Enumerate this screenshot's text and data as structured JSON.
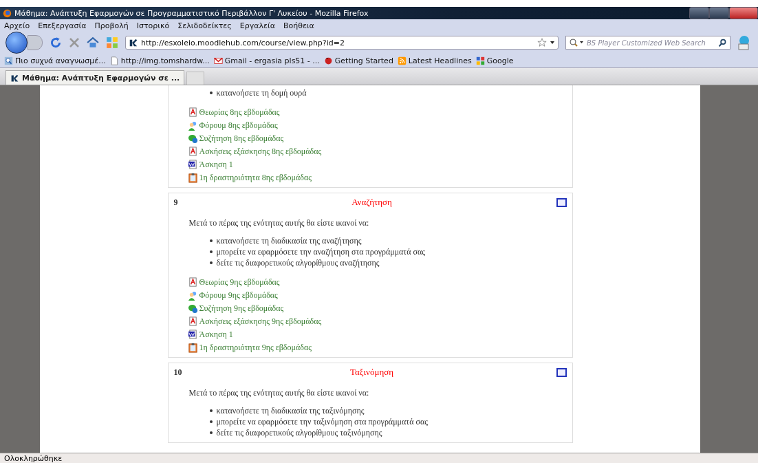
{
  "window": {
    "title": "Μάθημα: Ανάπτυξη Εφαρμογών σε Προγραμματιστικό Περιβάλλον Γ' Λυκείου - Mozilla Firefox"
  },
  "menu": [
    "Αρχείο",
    "Επεξεργασία",
    "Προβολή",
    "Ιστορικό",
    "Σελιδοδείκτες",
    "Εργαλεία",
    "Βοήθεια"
  ],
  "address": {
    "value": "http://esxoleio.moodlehub.com/course/view.php?id=2"
  },
  "search": {
    "placeholder": "BS Player Customized Web Search"
  },
  "bookmarks": [
    {
      "kind": "search",
      "label": "Πιο συχνά αναγνωσμέ..."
    },
    {
      "kind": "page",
      "label": "http://img.tomshardw..."
    },
    {
      "kind": "mail",
      "label": "Gmail - ergasia pls51 - ..."
    },
    {
      "kind": "fox",
      "label": "Getting Started"
    },
    {
      "kind": "rss",
      "label": "Latest Headlines"
    },
    {
      "kind": "google",
      "label": "Google"
    }
  ],
  "tabs": [
    {
      "label": "Μάθημα: Ανάπτυξη Εφαρμογών σε ...",
      "selected": true
    }
  ],
  "sections": [
    {
      "bullets": [
        "κατανοήσετε τη δομή ουρά"
      ],
      "resources": [
        {
          "kind": "pdf",
          "label": "Θεωρίας 8ης εβδομάδας"
        },
        {
          "kind": "forum",
          "label": "Φόρουμ 8ης εβδομάδας"
        },
        {
          "kind": "chat",
          "label": "Συζήτηση 8ης εβδομάδας"
        },
        {
          "kind": "pdf",
          "label": "Ασκήσεις εξάσκησης 8ης εβδομάδας"
        },
        {
          "kind": "word",
          "label": "Άσκηση 1"
        },
        {
          "kind": "assignment",
          "label": "1η δραστηριότητα 8ης εβδομάδας"
        }
      ]
    },
    {
      "number": "9",
      "title": "Αναζήτηση",
      "intro": "Μετά το πέρας της ενότητας αυτής θα είστε ικανοί να:",
      "bullets": [
        "κατανοήσετε τη διαδικασία της αναζήτησης",
        "μπορείτε να εφαρμόσετε την αναζήτηση στα προγράμματά σας",
        "δείτε τις διαφορετικούς αλγορίθμους αναζήτησης"
      ],
      "resources": [
        {
          "kind": "pdf",
          "label": "Θεωρίας 9ης εβδομάδας"
        },
        {
          "kind": "forum",
          "label": "Φόρουμ 9ης εβδομάδας"
        },
        {
          "kind": "chat",
          "label": "Συζήτηση 9ης εβδομάδας"
        },
        {
          "kind": "pdf",
          "label": "Ασκήσεις εξάσκησης 9ης εβδομάδας"
        },
        {
          "kind": "word",
          "label": "Άσκηση 1"
        },
        {
          "kind": "assignment",
          "label": "1η δραστηριότητα 9ης εβδομάδας"
        }
      ]
    },
    {
      "number": "10",
      "title": "Ταξινόμηση",
      "intro": "Μετά το πέρας της ενότητας αυτής θα είστε ικανοί να:",
      "bullets": [
        "κατανοήσετε τη διαδικασία της ταξινόμησης",
        "μπορείτε να εφαρμόσετε την ταξινόμηση στα προγράμματά σας",
        "δείτε τις διαφορετικούς αλγορίθμους ταξινόμησης"
      ]
    }
  ],
  "status_bar": {
    "text": "Ολοκληρώθηκε"
  }
}
